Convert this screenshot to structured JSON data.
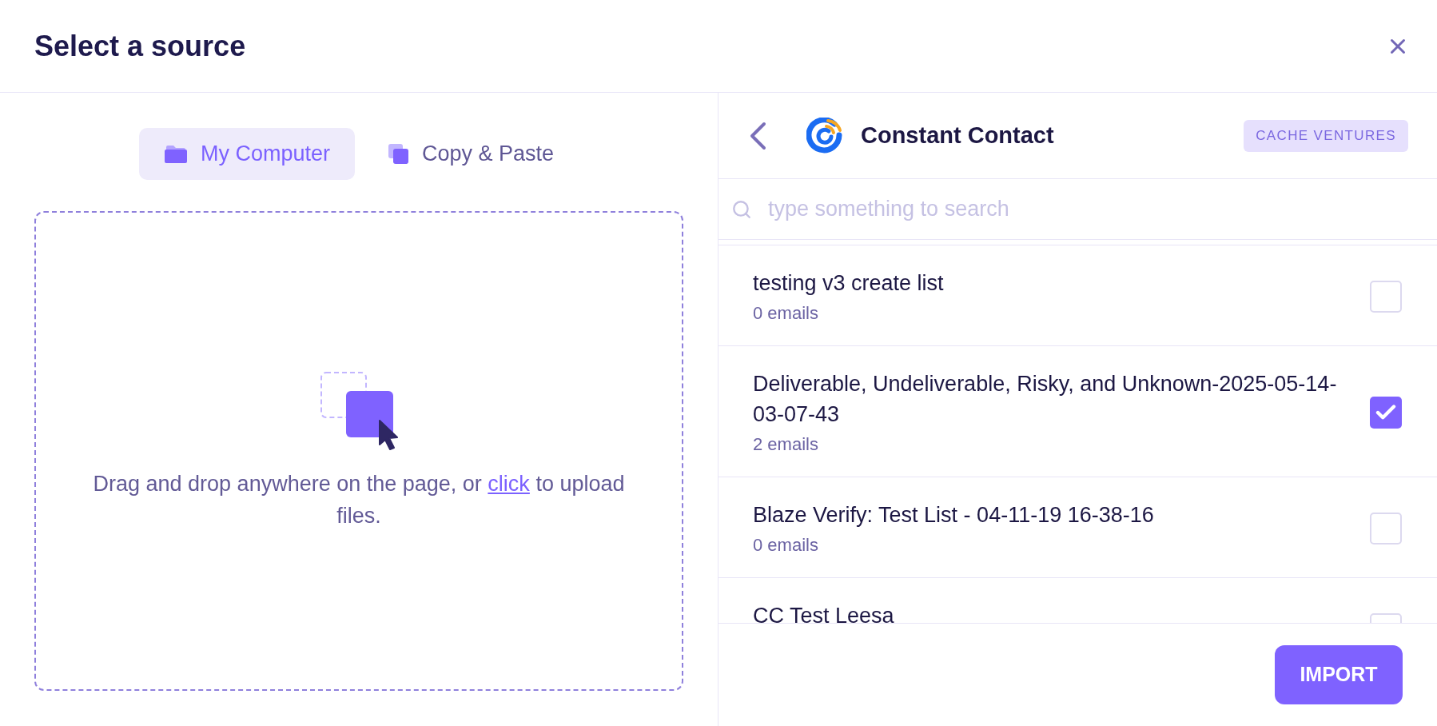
{
  "dialog": {
    "title": "Select a source"
  },
  "source_tabs": [
    {
      "kind": "folder",
      "label": "My Computer",
      "selected": true
    },
    {
      "kind": "copy",
      "label": "Copy & Paste",
      "selected": false
    }
  ],
  "dropzone": {
    "text_before": "Drag and drop anywhere on the page, or",
    "link": "click",
    "text_after": "to upload files."
  },
  "integration": {
    "name": "Constant Contact",
    "account": "CACHE VENTURES"
  },
  "search": {
    "placeholder": "type something to search"
  },
  "lists": [
    {
      "name": "testing v3 create list",
      "count": "0 emails",
      "checked": false
    },
    {
      "name": "Deliverable, Undeliverable, Risky, and Unknown-2025-05-14-03-07-43",
      "count": "2 emails",
      "checked": true
    },
    {
      "name": "Blaze Verify: Test List - 04-11-19 16-38-16",
      "count": "0 emails",
      "checked": false
    },
    {
      "name": "CC Test Leesa",
      "checked": false
    }
  ],
  "import_button": "IMPORT"
}
